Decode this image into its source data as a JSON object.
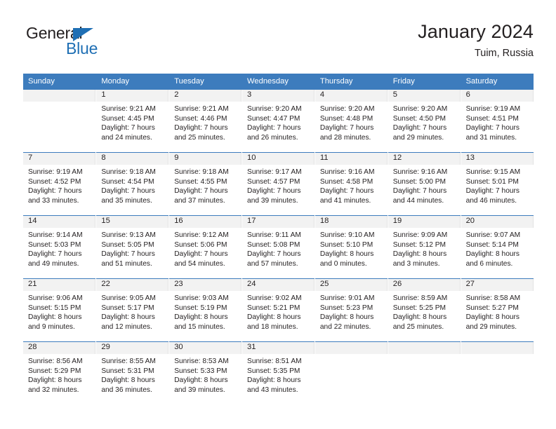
{
  "brand": {
    "name_part1": "General",
    "name_part2": "Blue",
    "accent_color": "#1f6fb4"
  },
  "header": {
    "month_title": "January 2024",
    "location": "Tuim, Russia",
    "header_bg_color": "#3d7cbd"
  },
  "weekday_headers": [
    "Sunday",
    "Monday",
    "Tuesday",
    "Wednesday",
    "Thursday",
    "Friday",
    "Saturday"
  ],
  "weeks": [
    [
      {
        "day": "",
        "detail": ""
      },
      {
        "day": "1",
        "detail": "Sunrise: 9:21 AM\nSunset: 4:45 PM\nDaylight: 7 hours\nand 24 minutes."
      },
      {
        "day": "2",
        "detail": "Sunrise: 9:21 AM\nSunset: 4:46 PM\nDaylight: 7 hours\nand 25 minutes."
      },
      {
        "day": "3",
        "detail": "Sunrise: 9:20 AM\nSunset: 4:47 PM\nDaylight: 7 hours\nand 26 minutes."
      },
      {
        "day": "4",
        "detail": "Sunrise: 9:20 AM\nSunset: 4:48 PM\nDaylight: 7 hours\nand 28 minutes."
      },
      {
        "day": "5",
        "detail": "Sunrise: 9:20 AM\nSunset: 4:50 PM\nDaylight: 7 hours\nand 29 minutes."
      },
      {
        "day": "6",
        "detail": "Sunrise: 9:19 AM\nSunset: 4:51 PM\nDaylight: 7 hours\nand 31 minutes."
      }
    ],
    [
      {
        "day": "7",
        "detail": "Sunrise: 9:19 AM\nSunset: 4:52 PM\nDaylight: 7 hours\nand 33 minutes."
      },
      {
        "day": "8",
        "detail": "Sunrise: 9:18 AM\nSunset: 4:54 PM\nDaylight: 7 hours\nand 35 minutes."
      },
      {
        "day": "9",
        "detail": "Sunrise: 9:18 AM\nSunset: 4:55 PM\nDaylight: 7 hours\nand 37 minutes."
      },
      {
        "day": "10",
        "detail": "Sunrise: 9:17 AM\nSunset: 4:57 PM\nDaylight: 7 hours\nand 39 minutes."
      },
      {
        "day": "11",
        "detail": "Sunrise: 9:16 AM\nSunset: 4:58 PM\nDaylight: 7 hours\nand 41 minutes."
      },
      {
        "day": "12",
        "detail": "Sunrise: 9:16 AM\nSunset: 5:00 PM\nDaylight: 7 hours\nand 44 minutes."
      },
      {
        "day": "13",
        "detail": "Sunrise: 9:15 AM\nSunset: 5:01 PM\nDaylight: 7 hours\nand 46 minutes."
      }
    ],
    [
      {
        "day": "14",
        "detail": "Sunrise: 9:14 AM\nSunset: 5:03 PM\nDaylight: 7 hours\nand 49 minutes."
      },
      {
        "day": "15",
        "detail": "Sunrise: 9:13 AM\nSunset: 5:05 PM\nDaylight: 7 hours\nand 51 minutes."
      },
      {
        "day": "16",
        "detail": "Sunrise: 9:12 AM\nSunset: 5:06 PM\nDaylight: 7 hours\nand 54 minutes."
      },
      {
        "day": "17",
        "detail": "Sunrise: 9:11 AM\nSunset: 5:08 PM\nDaylight: 7 hours\nand 57 minutes."
      },
      {
        "day": "18",
        "detail": "Sunrise: 9:10 AM\nSunset: 5:10 PM\nDaylight: 8 hours\nand 0 minutes."
      },
      {
        "day": "19",
        "detail": "Sunrise: 9:09 AM\nSunset: 5:12 PM\nDaylight: 8 hours\nand 3 minutes."
      },
      {
        "day": "20",
        "detail": "Sunrise: 9:07 AM\nSunset: 5:14 PM\nDaylight: 8 hours\nand 6 minutes."
      }
    ],
    [
      {
        "day": "21",
        "detail": "Sunrise: 9:06 AM\nSunset: 5:15 PM\nDaylight: 8 hours\nand 9 minutes."
      },
      {
        "day": "22",
        "detail": "Sunrise: 9:05 AM\nSunset: 5:17 PM\nDaylight: 8 hours\nand 12 minutes."
      },
      {
        "day": "23",
        "detail": "Sunrise: 9:03 AM\nSunset: 5:19 PM\nDaylight: 8 hours\nand 15 minutes."
      },
      {
        "day": "24",
        "detail": "Sunrise: 9:02 AM\nSunset: 5:21 PM\nDaylight: 8 hours\nand 18 minutes."
      },
      {
        "day": "25",
        "detail": "Sunrise: 9:01 AM\nSunset: 5:23 PM\nDaylight: 8 hours\nand 22 minutes."
      },
      {
        "day": "26",
        "detail": "Sunrise: 8:59 AM\nSunset: 5:25 PM\nDaylight: 8 hours\nand 25 minutes."
      },
      {
        "day": "27",
        "detail": "Sunrise: 8:58 AM\nSunset: 5:27 PM\nDaylight: 8 hours\nand 29 minutes."
      }
    ],
    [
      {
        "day": "28",
        "detail": "Sunrise: 8:56 AM\nSunset: 5:29 PM\nDaylight: 8 hours\nand 32 minutes."
      },
      {
        "day": "29",
        "detail": "Sunrise: 8:55 AM\nSunset: 5:31 PM\nDaylight: 8 hours\nand 36 minutes."
      },
      {
        "day": "30",
        "detail": "Sunrise: 8:53 AM\nSunset: 5:33 PM\nDaylight: 8 hours\nand 39 minutes."
      },
      {
        "day": "31",
        "detail": "Sunrise: 8:51 AM\nSunset: 5:35 PM\nDaylight: 8 hours\nand 43 minutes."
      },
      {
        "day": "",
        "detail": ""
      },
      {
        "day": "",
        "detail": ""
      },
      {
        "day": "",
        "detail": ""
      }
    ]
  ]
}
